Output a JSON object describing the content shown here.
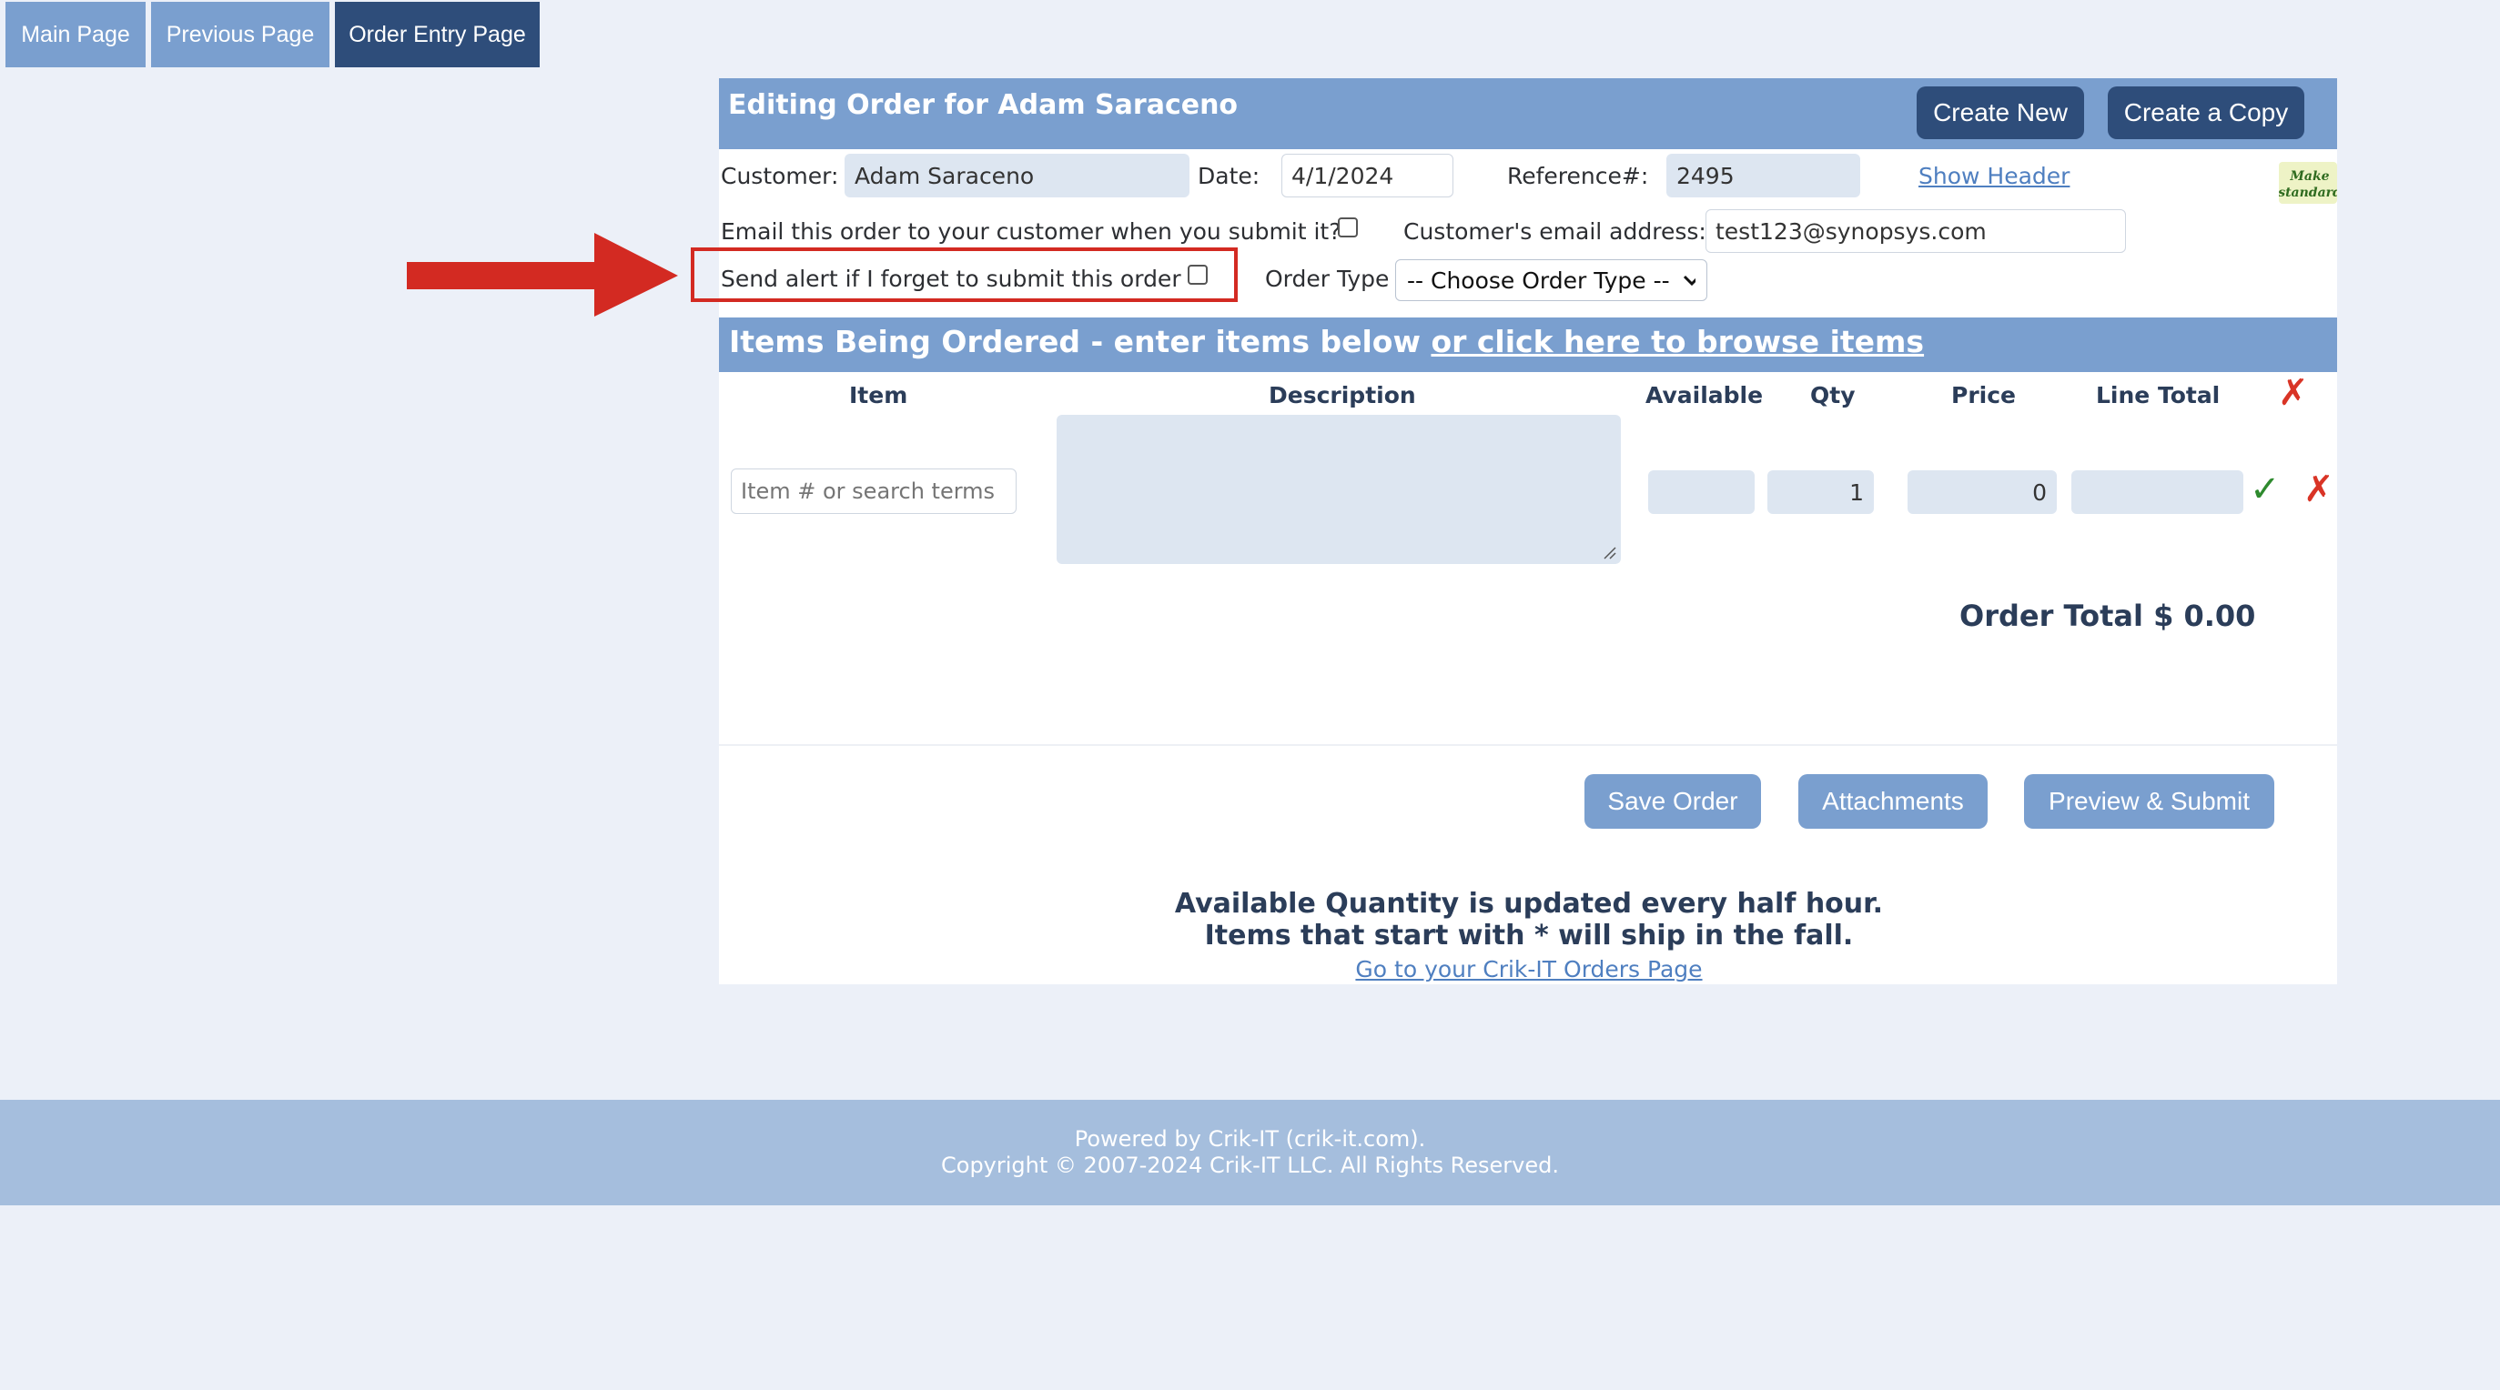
{
  "nav": {
    "tabs": [
      {
        "label": "Main Page"
      },
      {
        "label": "Previous Page"
      },
      {
        "label": "Order Entry Page"
      }
    ]
  },
  "header": {
    "title": "Editing Order for Adam Saraceno",
    "create_new": "Create New",
    "create_copy": "Create a Copy",
    "make_standard": "Make standard"
  },
  "form": {
    "customer_label": "Customer:",
    "customer_value": "Adam Saraceno",
    "date_label": "Date:",
    "date_value": "4/1/2024",
    "reference_label": "Reference#:",
    "reference_value": "2495",
    "show_header": "Show Header",
    "email_order_label": "Email this order to your customer when you submit it?",
    "customer_email_label": "Customer's email address:",
    "customer_email_value": "test123@synopsys.com",
    "send_alert_label": "Send alert if I forget to submit this order",
    "order_type_label": "Order Type",
    "order_type_value": "-- Choose Order Type --"
  },
  "items": {
    "bar_text": "Items Being Ordered - enter items below",
    "browse_link": "or click here to browse items",
    "columns": {
      "item": "Item",
      "description": "Description",
      "available": "Available",
      "qty": "Qty",
      "price": "Price",
      "line_total": "Line Total"
    },
    "row": {
      "item_placeholder": "Item # or search terms",
      "qty": "1",
      "price": "0"
    },
    "order_total": "Order Total $ 0.00"
  },
  "actions": {
    "save": "Save Order",
    "attachments": "Attachments",
    "preview": "Preview & Submit"
  },
  "notes": {
    "line1": "Available Quantity is updated every half hour.",
    "line2": "Items that start with * will ship in the fall.",
    "orders_link": "Go to your Crik-IT Orders Page"
  },
  "footer": {
    "line1": "Powered by Crik-IT (crik-it.com).",
    "line2": "Copyright © 2007-2024 Crik-IT LLC. All Rights Reserved."
  },
  "colors": {
    "nav_tab": "#7a9fcf",
    "nav_tab_active": "#2e4d7a",
    "header_bar": "#7a9fcf",
    "annotation_red": "#d32a22"
  }
}
